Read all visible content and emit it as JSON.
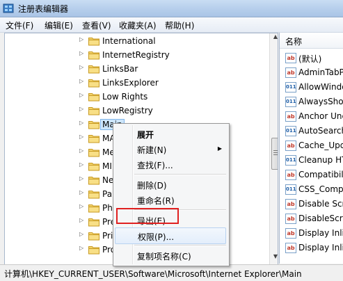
{
  "window": {
    "title": "注册表编辑器"
  },
  "menu": [
    "文件(F)",
    "编辑(E)",
    "查看(V)",
    "收藏夹(A)",
    "帮助(H)"
  ],
  "tree": {
    "items": [
      {
        "label": "International"
      },
      {
        "label": "InternetRegistry"
      },
      {
        "label": "LinksBar"
      },
      {
        "label": "LinksExplorer"
      },
      {
        "label": "Low Rights"
      },
      {
        "label": "LowRegistry"
      },
      {
        "label": "Main",
        "selected": true
      },
      {
        "label": "MA"
      },
      {
        "label": "Me"
      },
      {
        "label": "MI"
      },
      {
        "label": "Ne"
      },
      {
        "label": "Pa"
      },
      {
        "label": "Phi"
      },
      {
        "label": "Pre"
      },
      {
        "label": "Pri"
      },
      {
        "label": "Pro"
      }
    ]
  },
  "values_pane": {
    "column_header": "名称",
    "items": [
      {
        "name": "(默认)",
        "type": "string"
      },
      {
        "name": "AdminTabP",
        "type": "string"
      },
      {
        "name": "AllowWindo",
        "type": "dword"
      },
      {
        "name": "AlwaysShow",
        "type": "dword"
      },
      {
        "name": "Anchor Unc",
        "type": "string"
      },
      {
        "name": "AutoSearch",
        "type": "dword"
      },
      {
        "name": "Cache_Upd",
        "type": "string"
      },
      {
        "name": "Cleanup HT",
        "type": "dword"
      },
      {
        "name": "Compatibili",
        "type": "string"
      },
      {
        "name": "CSS_Compa",
        "type": "dword"
      },
      {
        "name": "Disable Scr",
        "type": "string"
      },
      {
        "name": "DisableScrip",
        "type": "string"
      },
      {
        "name": "Display Inli",
        "type": "string"
      },
      {
        "name": "Display Inli",
        "type": "string"
      }
    ]
  },
  "context_menu": {
    "items": [
      {
        "label": "展开",
        "bold": true
      },
      {
        "label": "新建(N)",
        "submenu": true
      },
      {
        "label": "查找(F)..."
      },
      {
        "separator": true
      },
      {
        "label": "删除(D)"
      },
      {
        "label": "重命名(R)"
      },
      {
        "separator": true
      },
      {
        "label": "导出(E)"
      },
      {
        "label": "权限(P)...",
        "highlighted": true
      },
      {
        "separator": true
      },
      {
        "label": "复制项名称(C)"
      }
    ]
  },
  "status": {
    "path": "计算机\\HKEY_CURRENT_USER\\Software\\Microsoft\\Internet Explorer\\Main"
  },
  "colors": {
    "highlight_box": "#e02020",
    "selection": "#cde6fb"
  }
}
